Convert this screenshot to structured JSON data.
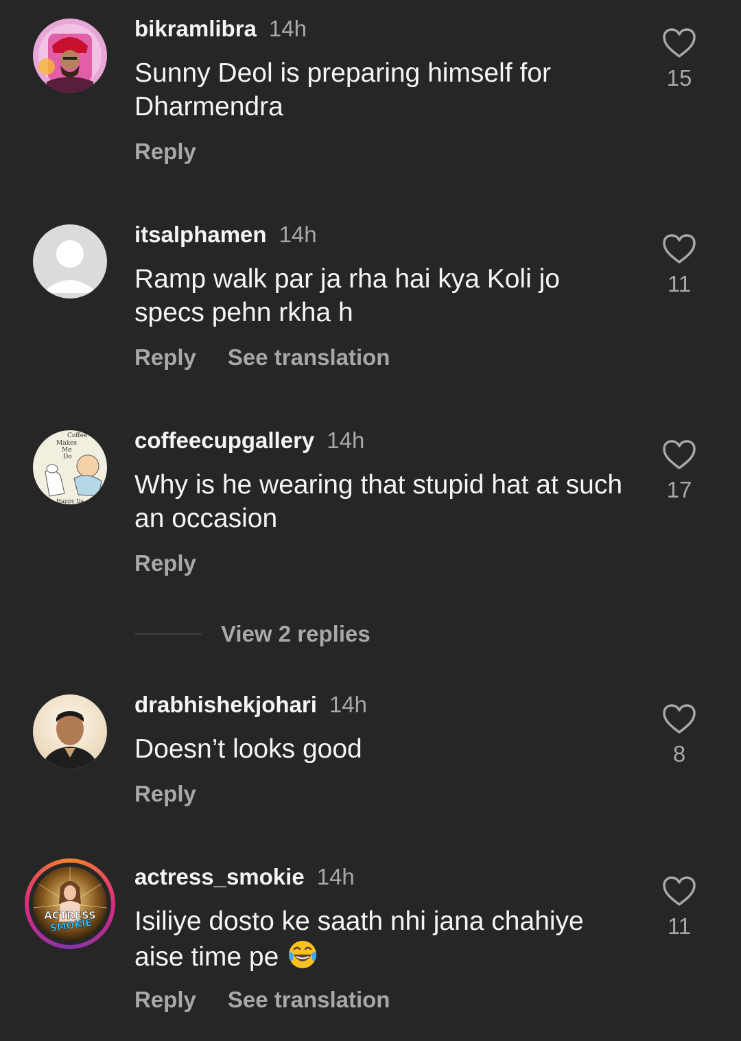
{
  "comments": [
    {
      "username": "bikramlibra",
      "time": "14h",
      "text": "Sunny Deol is preparing himself for Dharmendra",
      "likes": "15",
      "reply_label": "Reply"
    },
    {
      "username": "itsalphamen",
      "time": "14h",
      "text": "Ramp walk par ja rha hai kya Koli jo specs pehn rkha h",
      "likes": "11",
      "reply_label": "Reply",
      "translation_label": "See translation"
    },
    {
      "username": "coffeecupgallery",
      "time": "14h",
      "text": "Why is he wearing that stupid hat at such an occasion",
      "likes": "17",
      "reply_label": "Reply",
      "avatar_text": [
        "Coffee",
        "Makes",
        "Me",
        "Do",
        "Happy Da"
      ]
    },
    {
      "username": "drabhishekjohari",
      "time": "14h",
      "text": "Doesn’t looks good",
      "likes": "8",
      "reply_label": "Reply"
    },
    {
      "username": "actress_smokie",
      "time": "14h",
      "text": "Isiliye dosto ke saath nhi jana chahiye aise time pe",
      "emoji": "face-with-tears-of-joy",
      "likes": "11",
      "reply_label": "Reply",
      "translation_label": "See translation",
      "avatar_text": [
        "ACTRESS",
        "SMOKIE"
      ]
    }
  ],
  "view_replies_label": "View 2 replies",
  "colors": {
    "background": "#262626",
    "primary_text": "#f5f5f5",
    "secondary_text": "#a8a8a8",
    "story_ring": [
      "#f58529",
      "#dd2a7b",
      "#8134af"
    ]
  }
}
